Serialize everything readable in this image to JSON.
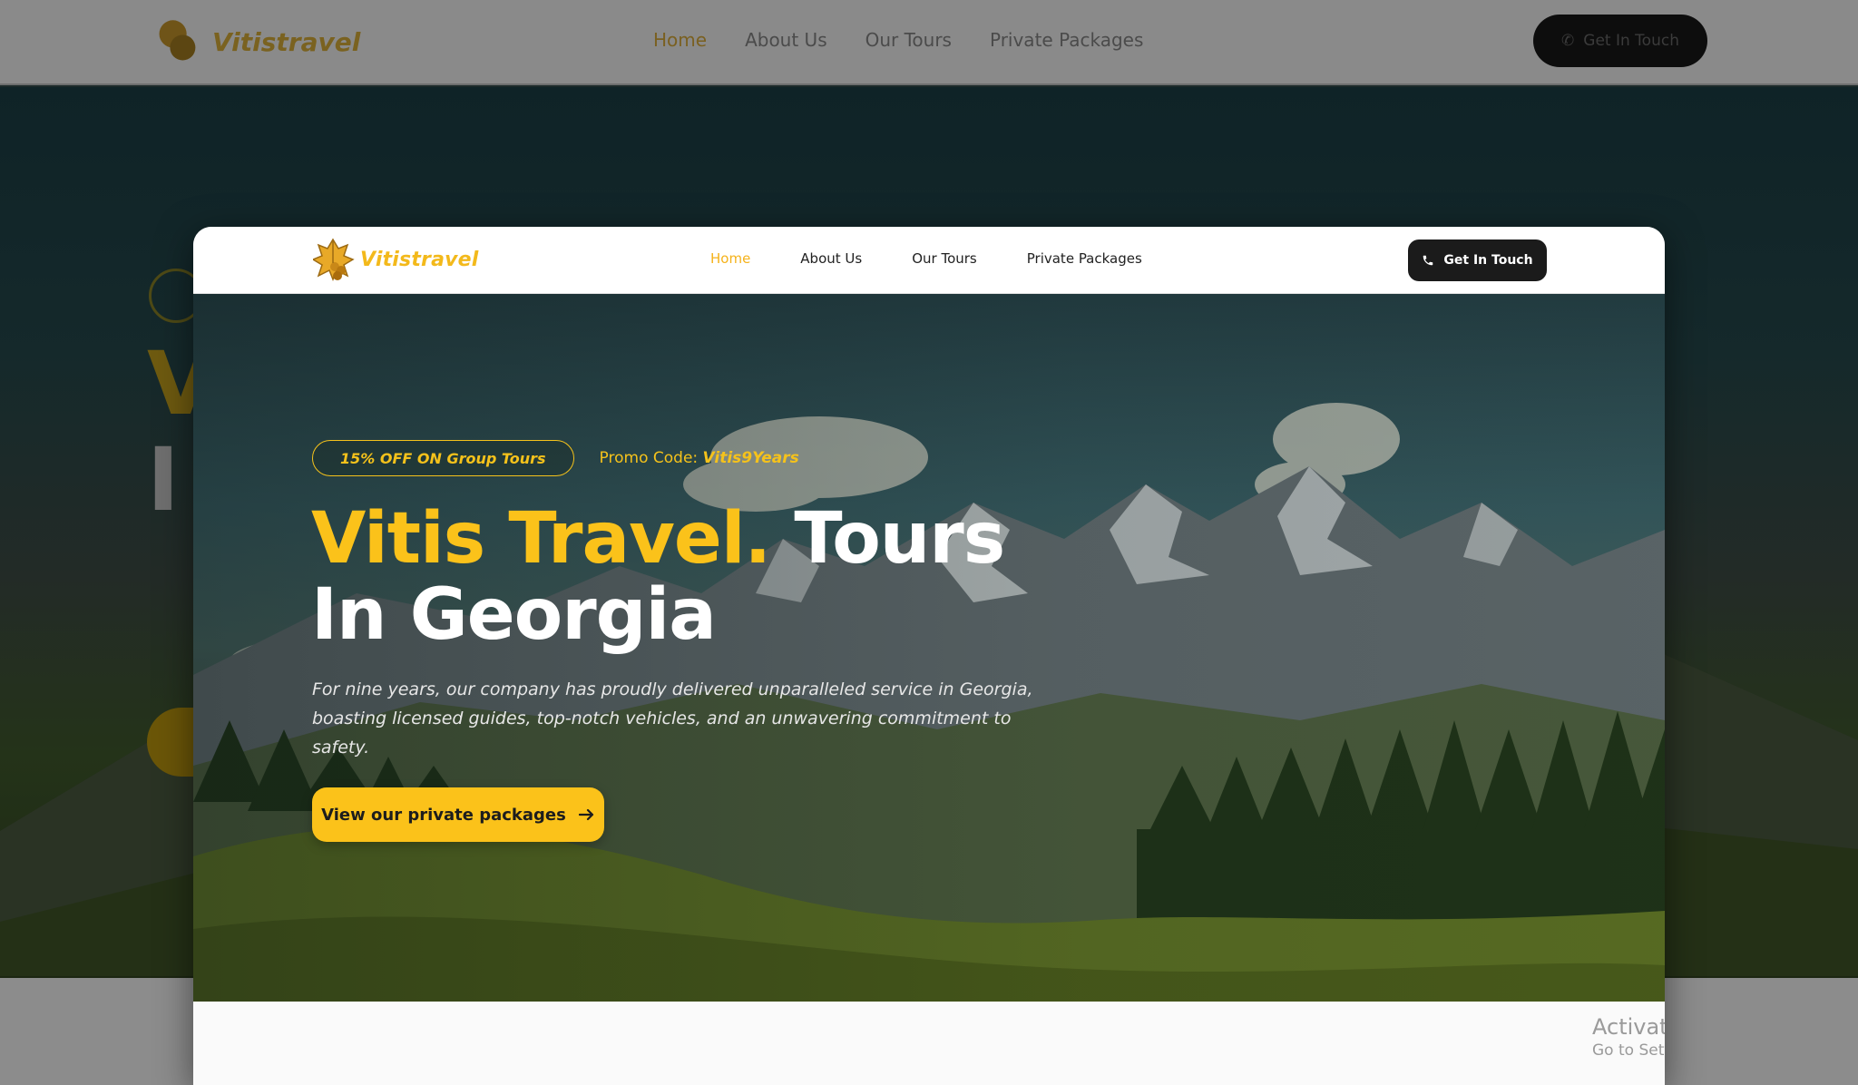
{
  "brand": {
    "name": "Vitistravel"
  },
  "nav": {
    "items": [
      "Home",
      "About Us",
      "Our Tours",
      "Private Packages"
    ],
    "active": "Home"
  },
  "cta": {
    "label": "Get In Touch",
    "icon": "phone-icon"
  },
  "hero": {
    "promo_pill": "15% OFF ON Group Tours",
    "promo_label": "Promo Code: ",
    "promo_code": "Vitis9Years",
    "title_highlight": "Vitis Travel.",
    "title_rest_1": "Tours",
    "title_rest_2": "In Georgia",
    "description": "For nine years, our company has proudly delivered unparalleled service in Georgia, boasting licensed guides, top-notch vehicles, and an unwavering commitment to safety.",
    "button_label": "View our private packages",
    "button_icon": "arrow-right-icon"
  },
  "watermark": {
    "line1": "Activate",
    "line2": "Go to Sett"
  },
  "colors": {
    "accent": "#fbc21a",
    "dark": "#1b1b1b",
    "nav_active": "#f5b21a"
  }
}
